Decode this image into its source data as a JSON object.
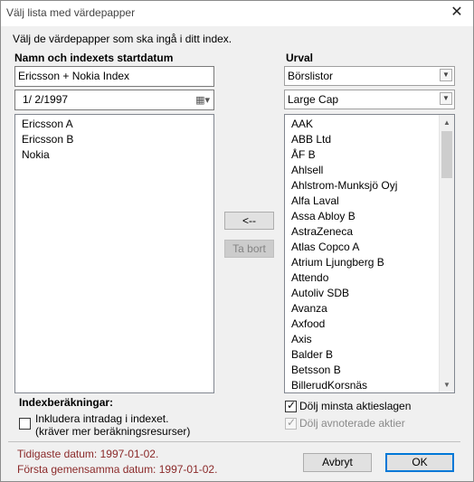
{
  "window": {
    "title": "Välj lista med värdepapper"
  },
  "instruction": "Välj de värdepapper som ska ingå i ditt index.",
  "left": {
    "heading": "Namn och indexets startdatum",
    "name_value": "Ericsson + Nokia Index",
    "date_value": "1/  2/1997",
    "selected": [
      "Ericsson A",
      "Ericsson B",
      "Nokia"
    ]
  },
  "right": {
    "heading": "Urval",
    "source_select": "Börslistor",
    "list_select": "Large Cap",
    "items": [
      "AAK",
      "ABB Ltd",
      "ÅF B",
      "Ahlsell",
      "Ahlstrom-Munksjö Oyj",
      "Alfa Laval",
      "Assa Abloy B",
      "AstraZeneca",
      "Atlas Copco A",
      "Atrium Ljungberg B",
      "Attendo",
      "Autoliv SDB",
      "Avanza",
      "Axfood",
      "Axis",
      "Balder B",
      "Betsson B",
      "BillerudKorsnäs"
    ]
  },
  "buttons": {
    "add_left": "<--",
    "remove": "Ta bort",
    "cancel": "Avbryt",
    "ok": "OK"
  },
  "calc": {
    "heading": "Indexberäkningar:",
    "intraday_line1": "Inkludera intradag i indexet.",
    "intraday_line2": "(kräver mer beräkningsresurser)"
  },
  "options": {
    "hide_smallest": "Dölj minsta aktieslagen",
    "hide_delisted": "Dölj avnoterade aktier"
  },
  "info": {
    "earliest": "Tidigaste datum: 1997-01-02.",
    "first_common": "Första gemensamma datum: 1997-01-02."
  },
  "icons": {
    "close": "close-icon",
    "calendar": "calendar-icon",
    "dropdown": "chevron-down-icon"
  }
}
